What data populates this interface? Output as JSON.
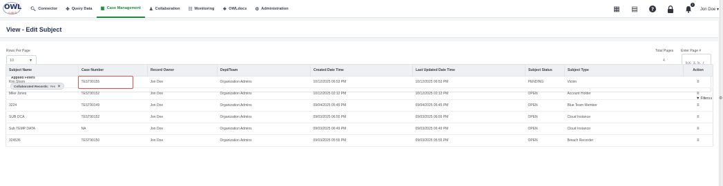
{
  "nav": {
    "logo_text": "OWL",
    "logo_sub": "CUBED",
    "items": [
      {
        "label": "Connector",
        "icon": "search-icon"
      },
      {
        "label": "Query Data",
        "icon": "share-nodes-icon"
      },
      {
        "label": "Case Management",
        "icon": "clipboard-icon",
        "active": true
      },
      {
        "label": "Collaboration",
        "icon": "people-icon"
      },
      {
        "label": "Monitoring",
        "icon": "monitor-list-icon"
      },
      {
        "label": "OWLdocs",
        "icon": "document-icon"
      },
      {
        "label": "Administration",
        "icon": "users-gear-icon"
      }
    ],
    "right_icons": [
      "dashboard-icon",
      "calendar-icon",
      "help-icon",
      "lock-icon",
      "bell-icon"
    ],
    "bell_count": "2",
    "user": "Jon Doe"
  },
  "page_title": "View - Edit Subject",
  "pagination": {
    "rows_per_page_label": "Rows Per Page",
    "rows_per_page_value": "10",
    "total_pages_label": "Total Pages",
    "total_pages_value": "4",
    "enter_page_label": "Enter Page #",
    "enter_page_placeholder": "Ex: 3, 5, 7"
  },
  "applied_filters": {
    "title": "Applied Filters",
    "chip_key": "Collaborated Records:",
    "chip_value": "Yes"
  },
  "filters_button": "Filters",
  "table": {
    "columns": [
      "Subject Name",
      "Case Number",
      "Record Owner",
      "Dept/Team",
      "Created Date Time",
      "Last Updated Date Time",
      "Subject Status",
      "Subject Type",
      "Action"
    ],
    "rows": [
      [
        "Kim Shorn",
        "TEST90155",
        "Jon Doe",
        "Organization Admins",
        "10/12/2025 06:53 PM",
        "10/12/2025 06:53 PM",
        "PENDING",
        "Victim"
      ],
      [
        "Mike Jones",
        "TEST90152",
        "Jon Doe",
        "Organization Admins",
        "10/12/2025 02:12 PM",
        "10/12/2025 02:12 PM",
        "OPEN",
        "Account Holder"
      ],
      [
        "3224",
        "TEST90149",
        "Jon Doe",
        "Organization Admins",
        "09/04/2025 05:45 PM",
        "09/04/2025 05:45 PM",
        "OPEN",
        "Blue Team Member"
      ],
      [
        "SUB OCA",
        "TEST90152",
        "Jon Doe",
        "Organization Admins",
        "09/03/2025 06:55 PM",
        "09/03/2025 06:55 PM",
        "OPEN",
        "Cloud Instance"
      ],
      [
        "Sub TEMP DATA",
        "NA",
        "Jon Doe",
        "Organization Admins",
        "09/03/2025 06:49 PM",
        "09/03/2025 06:49 PM",
        "OPEN",
        "Cloud Instance"
      ],
      [
        "324536",
        "TEST90150",
        "Jon Doe",
        "Organization Admins",
        "09/03/2025 05:55 PM",
        "09/03/2025 05:55 PM",
        "OPEN",
        "Breach Recorder"
      ]
    ]
  },
  "colors": {
    "accent_green": "#1a8a3b",
    "title_navy": "#1f2d55",
    "highlight_red": "#d9534f"
  }
}
